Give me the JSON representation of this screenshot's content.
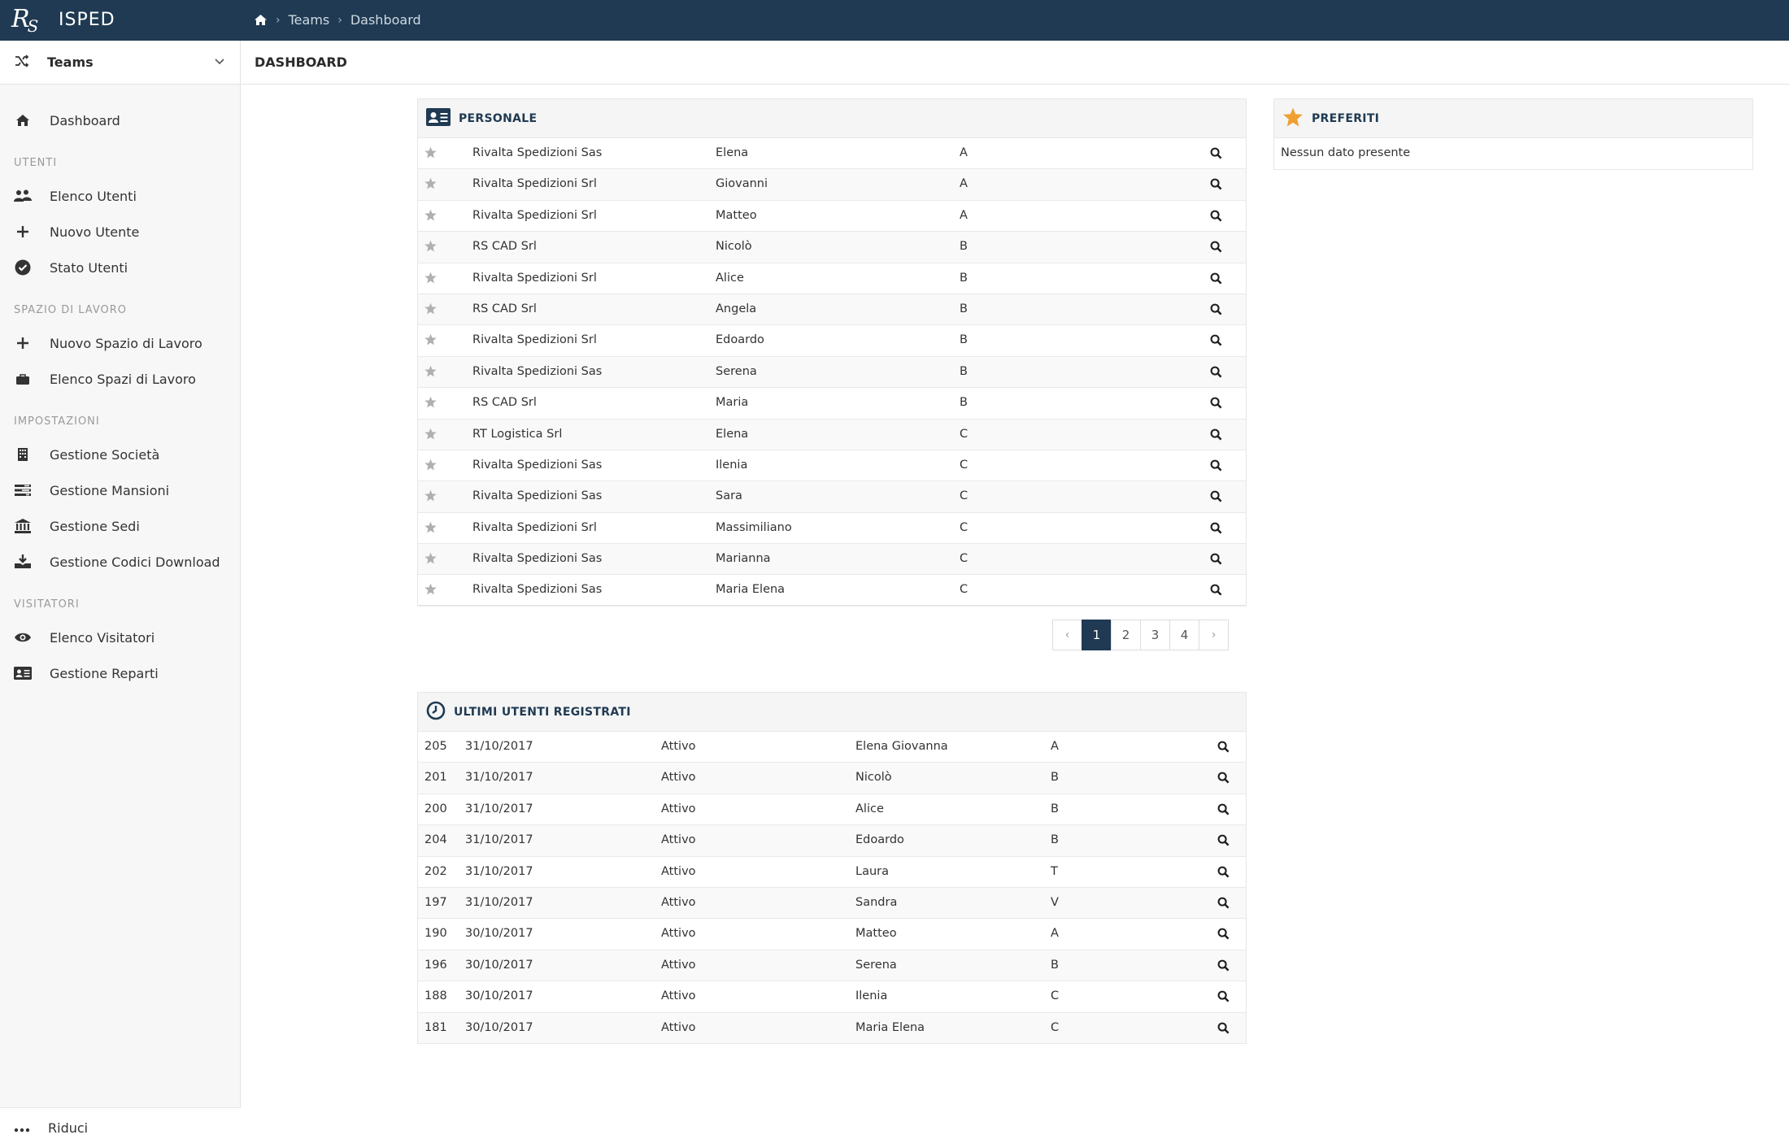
{
  "app": {
    "logo_text": "R",
    "logo_sub": "S",
    "title": "ISPED"
  },
  "breadcrumb": {
    "items": [
      "Teams",
      "Dashboard"
    ]
  },
  "sidebar": {
    "header_label": "Teams",
    "dashboard_label": "Dashboard",
    "sections": {
      "utenti": "UTENTI",
      "spazio": "SPAZIO DI LAVORO",
      "impostazioni": "IMPOSTAZIONI",
      "visitatori": "VISITATORI"
    },
    "items": {
      "elenco_utenti": "Elenco Utenti",
      "nuovo_utente": "Nuovo Utente",
      "stato_utenti": "Stato Utenti",
      "nuovo_spazio": "Nuovo Spazio di Lavoro",
      "elenco_spazi": "Elenco Spazi di Lavoro",
      "gestione_societa": "Gestione Società",
      "gestione_mansioni": "Gestione Mansioni",
      "gestione_sedi": "Gestione Sedi",
      "gestione_codici": "Gestione Codici Download",
      "elenco_visitatori": "Elenco Visitatori",
      "gestione_reparti": "Gestione Reparti"
    },
    "footer_label": "Riduci"
  },
  "main": {
    "title": "DASHBOARD"
  },
  "personale": {
    "title": "PERSONALE",
    "rows": [
      [
        "Rivalta Spedizioni Sas",
        "Elena",
        "A"
      ],
      [
        "Rivalta Spedizioni Srl",
        "Giovanni",
        "A"
      ],
      [
        "Rivalta Spedizioni Srl",
        "Matteo",
        "A"
      ],
      [
        "RS CAD Srl",
        "Nicolò",
        "B"
      ],
      [
        "Rivalta Spedizioni Srl",
        "Alice",
        "B"
      ],
      [
        "RS CAD Srl",
        "Angela",
        "B"
      ],
      [
        "Rivalta Spedizioni Srl",
        "Edoardo",
        "B"
      ],
      [
        "Rivalta Spedizioni Sas",
        "Serena",
        "B"
      ],
      [
        "RS CAD Srl",
        "Maria",
        "B"
      ],
      [
        "RT Logistica Srl",
        "Elena",
        "C"
      ],
      [
        "Rivalta Spedizioni Sas",
        "Ilenia",
        "C"
      ],
      [
        "Rivalta Spedizioni Sas",
        "Sara",
        "C"
      ],
      [
        "Rivalta Spedizioni Srl",
        "Massimiliano",
        "C"
      ],
      [
        "Rivalta Spedizioni Sas",
        "Marianna",
        "C"
      ],
      [
        "Rivalta Spedizioni Sas",
        "Maria Elena",
        "C"
      ]
    ]
  },
  "pagination": {
    "prev": "‹",
    "pages": [
      "1",
      "2",
      "3",
      "4"
    ],
    "active": "1",
    "next": "›"
  },
  "preferiti": {
    "title": "PREFERITI",
    "empty": "Nessun dato presente"
  },
  "ultimi": {
    "title": "ULTIMI UTENTI REGISTRATI",
    "rows": [
      [
        "205",
        "31/10/2017",
        "Attivo",
        "Elena Giovanna",
        "A"
      ],
      [
        "201",
        "31/10/2017",
        "Attivo",
        "Nicolò",
        "B"
      ],
      [
        "200",
        "31/10/2017",
        "Attivo",
        "Alice",
        "B"
      ],
      [
        "204",
        "31/10/2017",
        "Attivo",
        "Edoardo",
        "B"
      ],
      [
        "202",
        "31/10/2017",
        "Attivo",
        "Laura",
        "T"
      ],
      [
        "197",
        "31/10/2017",
        "Attivo",
        "Sandra",
        "V"
      ],
      [
        "190",
        "30/10/2017",
        "Attivo",
        "Matteo",
        "A"
      ],
      [
        "196",
        "30/10/2017",
        "Attivo",
        "Serena",
        "B"
      ],
      [
        "188",
        "30/10/2017",
        "Attivo",
        "Ilenia",
        "C"
      ],
      [
        "181",
        "30/10/2017",
        "Attivo",
        "Maria Elena",
        "C"
      ]
    ]
  },
  "colors": {
    "topbar": "#1f3a52",
    "accent_star": "#f0a030",
    "fav_star": "#b0b0b0"
  }
}
